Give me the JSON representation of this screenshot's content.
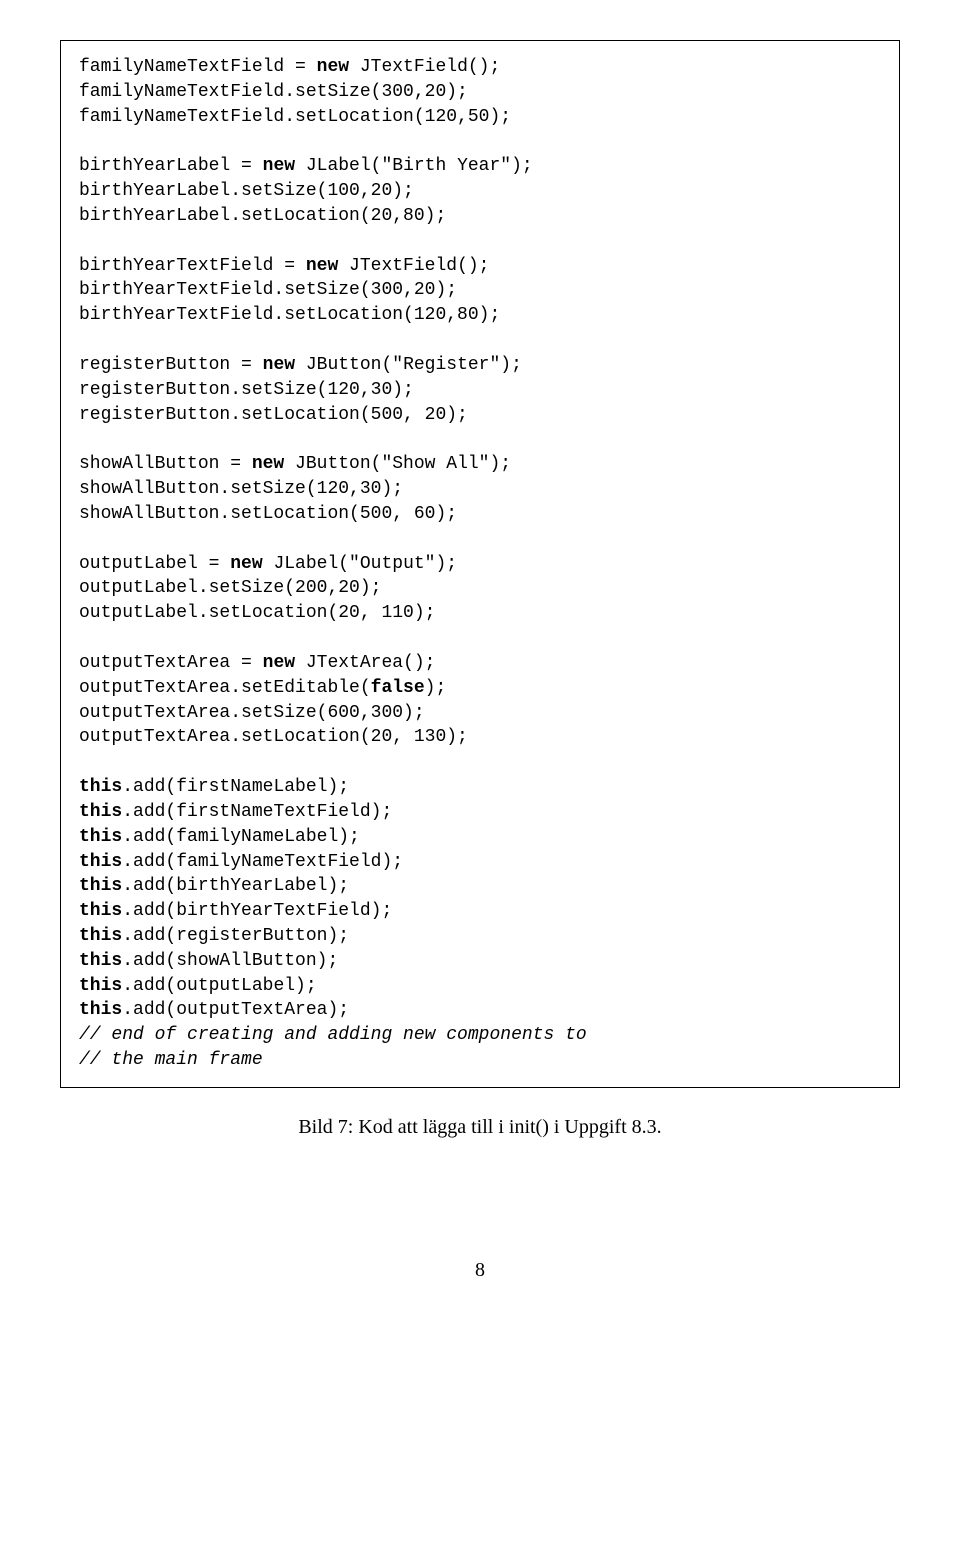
{
  "code": {
    "l01a": "familyNameTextField = ",
    "l01k": "new",
    "l01b": " JTextField();",
    "l02": "familyNameTextField.setSize(300,20);",
    "l03": "familyNameTextField.setLocation(120,50);",
    "l04": "",
    "l05a": "birthYearLabel = ",
    "l05k": "new",
    "l05b": " JLabel(\"Birth Year\");",
    "l06": "birthYearLabel.setSize(100,20);",
    "l07": "birthYearLabel.setLocation(20,80);",
    "l08": "",
    "l09a": "birthYearTextField = ",
    "l09k": "new",
    "l09b": " JTextField();",
    "l10": "birthYearTextField.setSize(300,20);",
    "l11": "birthYearTextField.setLocation(120,80);",
    "l12": "",
    "l13a": "registerButton = ",
    "l13k": "new",
    "l13b": " JButton(\"Register\");",
    "l14": "registerButton.setSize(120,30);",
    "l15": "registerButton.setLocation(500, 20);",
    "l16": "",
    "l17a": "showAllButton = ",
    "l17k": "new",
    "l17b": " JButton(\"Show All\");",
    "l18": "showAllButton.setSize(120,30);",
    "l19": "showAllButton.setLocation(500, 60);",
    "l20": "",
    "l21a": "outputLabel = ",
    "l21k": "new",
    "l21b": " JLabel(\"Output\");",
    "l22": "outputLabel.setSize(200,20);",
    "l23": "outputLabel.setLocation(20, 110);",
    "l24": "",
    "l25a": "outputTextArea = ",
    "l25k": "new",
    "l25b": " JTextArea();",
    "l26a": "outputTextArea.setEditable(",
    "l26k": "false",
    "l26b": ");",
    "l27": "outputTextArea.setSize(600,300);",
    "l28": "outputTextArea.setLocation(20, 130);",
    "l29": "",
    "l30k": "this",
    "l30b": ".add(firstNameLabel);",
    "l31k": "this",
    "l31b": ".add(firstNameTextField);",
    "l32k": "this",
    "l32b": ".add(familyNameLabel);",
    "l33k": "this",
    "l33b": ".add(familyNameTextField);",
    "l34k": "this",
    "l34b": ".add(birthYearLabel);",
    "l35k": "this",
    "l35b": ".add(birthYearTextField);",
    "l36k": "this",
    "l36b": ".add(registerButton);",
    "l37k": "this",
    "l37b": ".add(showAllButton);",
    "l38k": "this",
    "l38b": ".add(outputLabel);",
    "l39k": "this",
    "l39b": ".add(outputTextArea);",
    "l40c": "// end of creating and adding new components to",
    "l41c": "// the main frame"
  },
  "caption": "Bild 7: Kod att lägga till i init() i Uppgift 8.3.",
  "pageNumber": "8"
}
